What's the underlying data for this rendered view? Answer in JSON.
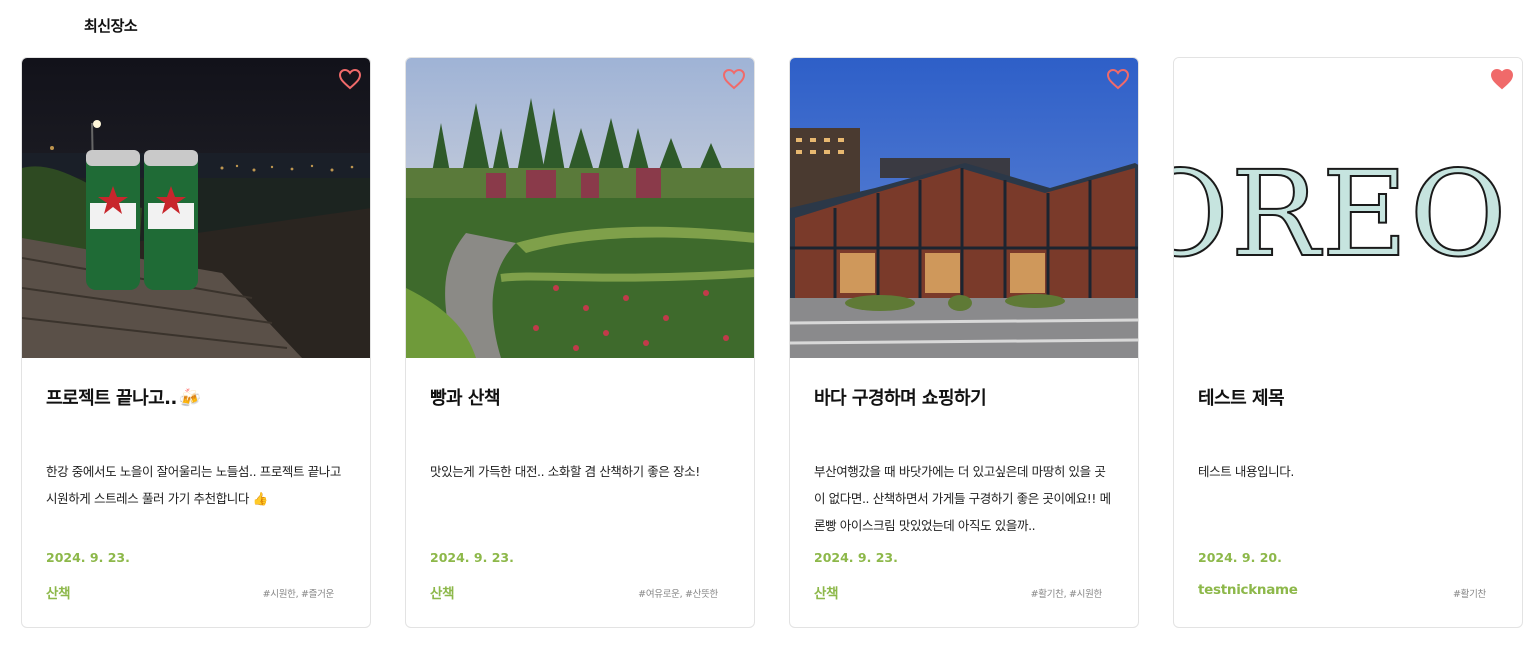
{
  "section": {
    "title": "최신장소"
  },
  "colors": {
    "accent": "#8db84a",
    "heart_outline": "#f06a6a",
    "heart_filled": "#f06a6a",
    "border": "#e3e3e3"
  },
  "cards": [
    {
      "title": "프로젝트 끝나고..",
      "title_emoji": "🍻",
      "description": "한강 중에서도 노을이 잘어울리는 노들섬.. 프로젝트 끝나고 시원하게 스트레스 풀러 가기 추천합니다 👍",
      "date": "2024. 9. 23.",
      "category": "산책",
      "tags": "#시원한, #즐거운",
      "liked": false,
      "image": "night-riverside-beer-cans"
    },
    {
      "title": "빵과 산책",
      "title_emoji": "",
      "description": "맛있는게 가득한 대전.. 소화할 겸 산책하기 좋은 장소!",
      "date": "2024. 9. 23.",
      "category": "산책",
      "tags": "#여유로운, #산뜻한",
      "liked": false,
      "image": "rose-garden-path"
    },
    {
      "title": "바다 구경하며 쇼핑하기",
      "title_emoji": "",
      "description": "부산여행갔을 때 바닷가에는 더 있고싶은데 마땅히 있을 곳이 없다면.. 산책하면서 가게들 구경하기 좋은 곳이에요!! 메론빵 아이스크림 맛있었는데 아직도 있을까..",
      "date": "2024. 9. 23.",
      "category": "산책",
      "tags": "#활기찬, #시원한",
      "liked": false,
      "image": "glass-market-building-dusk"
    },
    {
      "title": "테스트 제목",
      "title_emoji": "",
      "description": "테스트 내용입니다.",
      "date": "2024. 9. 20.",
      "category": "testnickname",
      "tags": "#활기찬",
      "liked": true,
      "image": "outlined-serif-text",
      "image_text": "OREO"
    }
  ]
}
